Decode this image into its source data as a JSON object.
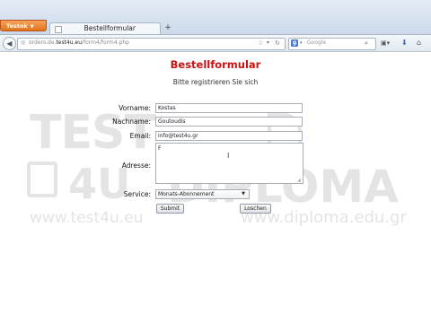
{
  "browser": {
    "app_button": "Testok",
    "tab_title": "Bestellformular",
    "new_tab": "+",
    "url_prefix": "orders.de.",
    "url_domain": "test4u.eu",
    "url_path": "/form4/form4.php",
    "search_placeholder": "Google",
    "search_engine_letter": "g",
    "icons": {
      "back": "back-arrow-icon",
      "star": "bookmark-star-icon",
      "reload": "reload-icon",
      "search": "magnifier-icon",
      "bookmarks": "bookmarks-menu-icon",
      "downloads": "download-icon",
      "home": "home-icon"
    }
  },
  "watermark": {
    "logo_top": "TEST",
    "logo_bottom": "4U",
    "url_left": "www.test4u.eu",
    "brand_right": "DIPLOMA",
    "url_right": "www.diploma.edu.gr"
  },
  "form": {
    "title": "Bestellformular",
    "subtitle": "Bitte registrieren Sie sich",
    "title_color": "#cc1111",
    "fields": {
      "vorname": {
        "label": "Vorname:",
        "value": "Kostas"
      },
      "nachname": {
        "label": "Nachname:",
        "value": "Goutoudis"
      },
      "email": {
        "label": "Email:",
        "value": "info@test4u.gr"
      },
      "adresse": {
        "label": "Adresse:",
        "value": "F"
      },
      "service": {
        "label": "Service:",
        "selected": "Monats-Abonnement"
      }
    },
    "submit_label": "Submit",
    "reset_label": "Loschen"
  }
}
